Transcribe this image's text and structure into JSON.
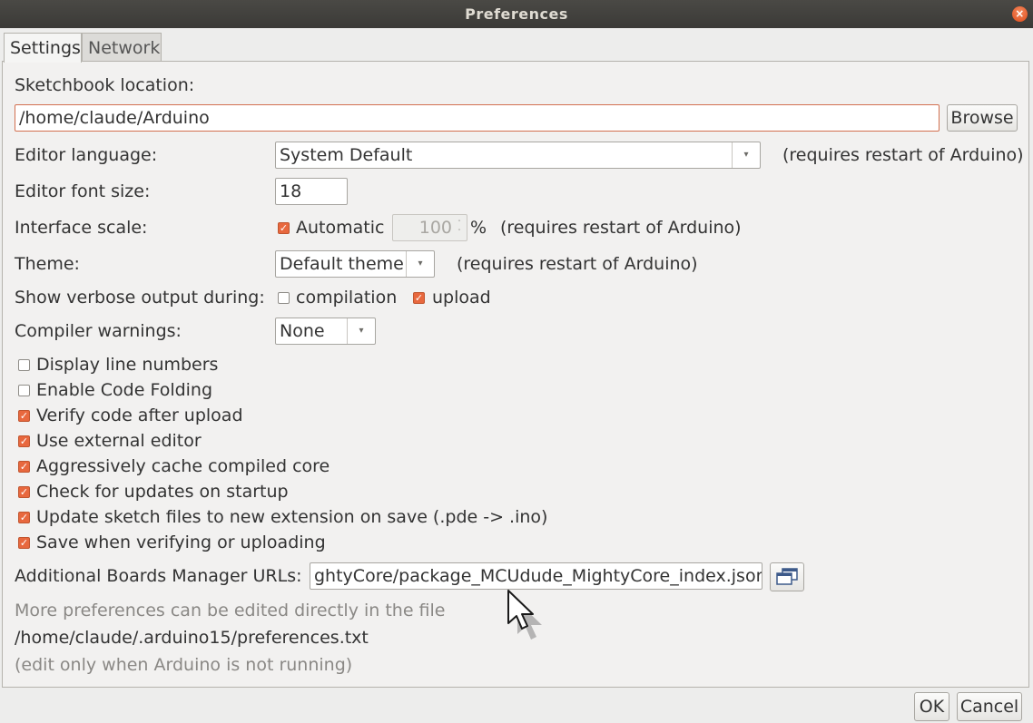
{
  "window": {
    "title": "Preferences",
    "close_glyph": "×"
  },
  "tabs": [
    {
      "label": "Settings",
      "active": true
    },
    {
      "label": "Network",
      "active": false
    }
  ],
  "sketchbook": {
    "label": "Sketchbook location:",
    "value": "/home/claude/Arduino",
    "browse_label": "Browse"
  },
  "editor_language": {
    "label": "Editor language:",
    "value": "System Default",
    "note": "(requires restart of Arduino)"
  },
  "font_size": {
    "label": "Editor font size:",
    "value": "18"
  },
  "interface_scale": {
    "label": "Interface scale:",
    "automatic_label": "Automatic",
    "automatic_checked": true,
    "value": "100",
    "unit": "%",
    "note": "(requires restart of Arduino)"
  },
  "theme": {
    "label": "Theme:",
    "value": "Default theme",
    "note": "(requires restart of Arduino)"
  },
  "verbose": {
    "label": "Show verbose output during:",
    "compilation_label": "compilation",
    "compilation_checked": false,
    "upload_label": "upload",
    "upload_checked": true
  },
  "compiler_warnings": {
    "label": "Compiler warnings:",
    "value": "None"
  },
  "checkboxes": [
    {
      "label": "Display line numbers",
      "checked": false
    },
    {
      "label": "Enable Code Folding",
      "checked": false
    },
    {
      "label": "Verify code after upload",
      "checked": true
    },
    {
      "label": "Use external editor",
      "checked": true
    },
    {
      "label": "Aggressively cache compiled core",
      "checked": true
    },
    {
      "label": "Check for updates on startup",
      "checked": true
    },
    {
      "label": "Update sketch files to new extension on save (.pde -> .ino)",
      "checked": true
    },
    {
      "label": "Save when verifying or uploading",
      "checked": true
    }
  ],
  "boards_urls": {
    "label": "Additional Boards Manager URLs:",
    "value": "ghtyCore/package_MCUdude_MightyCore_index.json"
  },
  "footer_info": {
    "line1": "More preferences can be edited directly in the file",
    "path": "/home/claude/.arduino15/preferences.txt",
    "line3": "(edit only when Arduino is not running)"
  },
  "buttons": {
    "ok": "OK",
    "cancel": "Cancel"
  },
  "icons": {
    "dropdown": "▾",
    "spin_up": "˄",
    "spin_down": "˅",
    "check": "✓"
  },
  "colors": {
    "accent": "#e8683e",
    "titlebar": "#3c3b37",
    "background": "#f2f1f0"
  }
}
